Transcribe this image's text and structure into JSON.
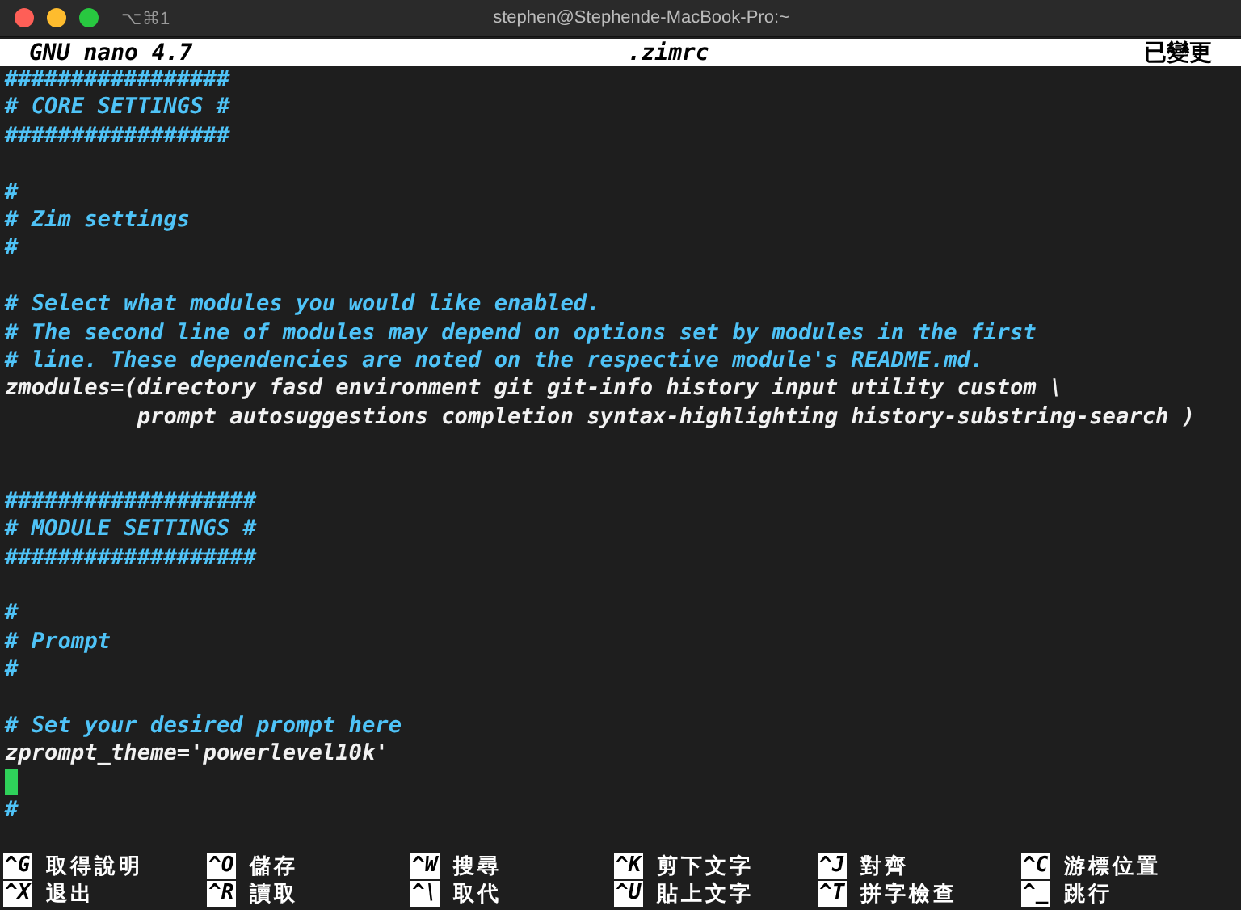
{
  "window": {
    "shortcut": "⌥⌘1",
    "title": "stephen@Stephende-MacBook-Pro:~"
  },
  "header": {
    "app": "GNU nano 4.7",
    "file": ".zimrc",
    "status": "已變更"
  },
  "lines": [
    {
      "kind": "comment",
      "text": "#################"
    },
    {
      "kind": "comment",
      "text": "# CORE SETTINGS #"
    },
    {
      "kind": "comment",
      "text": "#################"
    },
    {
      "kind": "blank"
    },
    {
      "kind": "comment",
      "text": "#"
    },
    {
      "kind": "comment",
      "text": "# Zim settings"
    },
    {
      "kind": "comment",
      "text": "#"
    },
    {
      "kind": "blank"
    },
    {
      "kind": "comment",
      "text": "# Select what modules you would like enabled."
    },
    {
      "kind": "comment",
      "text": "# The second line of modules may depend on options set by modules in the first"
    },
    {
      "kind": "comment",
      "text": "# line. These dependencies are noted on the respective module's README.md."
    },
    {
      "kind": "code",
      "text": "zmodules=(directory fasd environment git git-info history input utility custom \\"
    },
    {
      "kind": "code",
      "text": "          prompt autosuggestions completion syntax-highlighting history-substring-search )"
    },
    {
      "kind": "blank"
    },
    {
      "kind": "blank"
    },
    {
      "kind": "comment",
      "text": "###################"
    },
    {
      "kind": "comment",
      "text": "# MODULE SETTINGS #"
    },
    {
      "kind": "comment",
      "text": "###################"
    },
    {
      "kind": "blank"
    },
    {
      "kind": "comment",
      "text": "#"
    },
    {
      "kind": "comment",
      "text": "# Prompt"
    },
    {
      "kind": "comment",
      "text": "#"
    },
    {
      "kind": "blank"
    },
    {
      "kind": "comment",
      "text": "# Set your desired prompt here"
    },
    {
      "kind": "code",
      "text": "zprompt_theme='powerlevel10k'"
    },
    {
      "kind": "cursor"
    },
    {
      "kind": "comment",
      "text": "#"
    }
  ],
  "shortcuts": [
    {
      "key": "^G",
      "label": "取得說明"
    },
    {
      "key": "^X",
      "label": "退出"
    },
    {
      "key": "^O",
      "label": "儲存"
    },
    {
      "key": "^R",
      "label": "讀取"
    },
    {
      "key": "^W",
      "label": "搜尋"
    },
    {
      "key": "^\\",
      "label": "取代"
    },
    {
      "key": "^K",
      "label": "剪下文字"
    },
    {
      "key": "^U",
      "label": "貼上文字"
    },
    {
      "key": "^J",
      "label": "對齊"
    },
    {
      "key": "^T",
      "label": "拼字檢查"
    },
    {
      "key": "^C",
      "label": "游標位置"
    },
    {
      "key": "^_",
      "label": "跳行"
    }
  ]
}
